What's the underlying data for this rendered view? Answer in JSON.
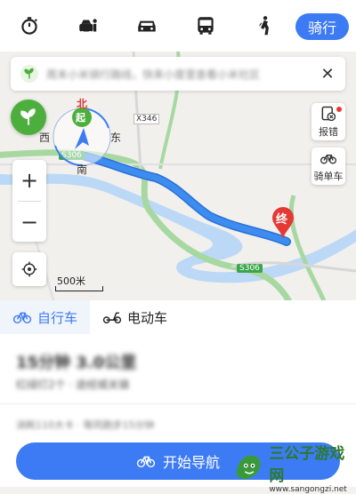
{
  "topbar": {
    "modes": [
      {
        "icon": "taxi-timer-icon"
      },
      {
        "icon": "ride-hailing-icon"
      },
      {
        "icon": "car-icon"
      },
      {
        "icon": "bus-icon"
      },
      {
        "icon": "walk-icon"
      }
    ],
    "active_mode": "骑行"
  },
  "tip": {
    "text": "周末小米骑行路线，快来小度里查看小米社区"
  },
  "map": {
    "compass_north": "北",
    "compass_start": "起",
    "compass_west": "西",
    "compass_east": "东",
    "compass_south": "南",
    "road_x346": "X346",
    "road_s306_a": "S306",
    "road_s306_b": "S306",
    "end_marker": "终",
    "report_label": "报错",
    "bike_label": "骑单车",
    "zoom_in": "+",
    "zoom_out": "−",
    "scale_label": "500米"
  },
  "panel": {
    "tabs": [
      {
        "label": "自行车",
        "icon": "bicycle-icon",
        "active": true
      },
      {
        "label": "电动车",
        "icon": "scooter-icon",
        "active": false
      }
    ],
    "summary": "15分钟 3.0公里",
    "subinfo": "红绿灯2个 · 途经城关镇",
    "note": "消耗110大卡 · 等同跑步15分钟",
    "start_nav": "开始导航"
  },
  "watermark": {
    "title": "三公子游戏网",
    "url": "www.sangongzi.net"
  },
  "colors": {
    "accent": "#3d7bf5",
    "route": "#3d8df0",
    "end_marker": "#e53935",
    "leaf_green": "#4caf3d"
  }
}
